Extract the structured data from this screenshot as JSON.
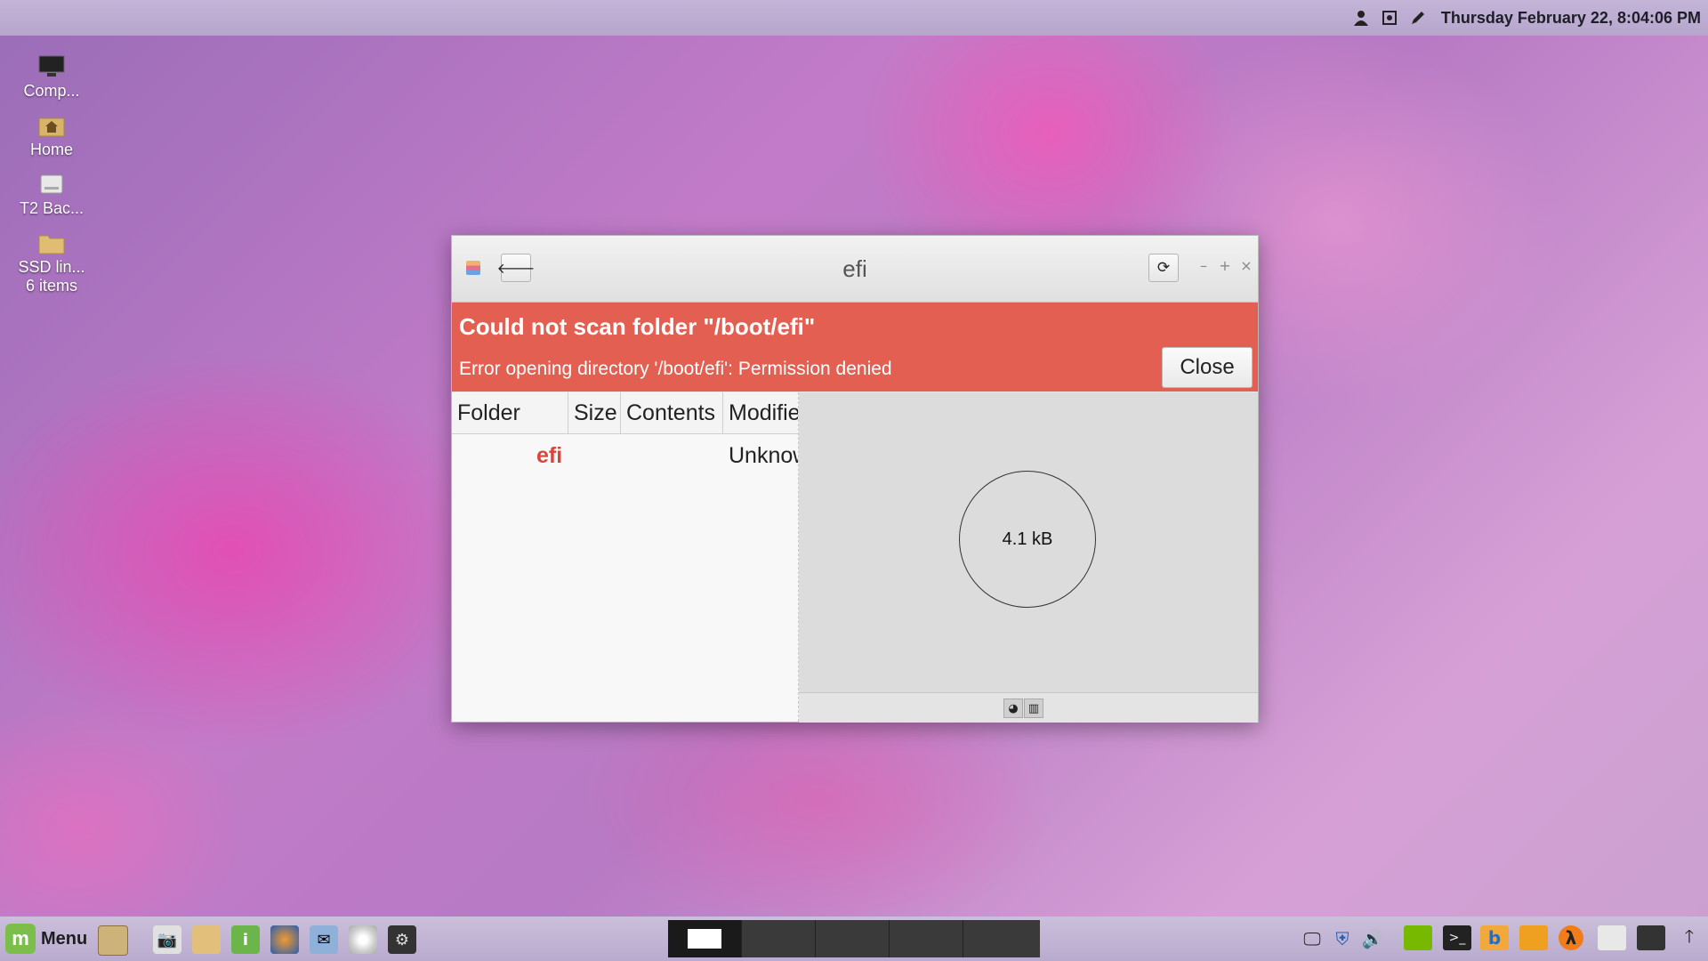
{
  "top_panel": {
    "clock": "Thursday February 22,  8:04:06 PM",
    "icons": [
      "user-icon",
      "screenshot-icon",
      "pen-icon"
    ]
  },
  "desktop": {
    "icons": [
      {
        "label": "Comp...",
        "sublabel": "",
        "icon": "computer-icon"
      },
      {
        "label": "Home",
        "sublabel": "",
        "icon": "home-folder-icon"
      },
      {
        "label": "T2 Bac...",
        "sublabel": "",
        "icon": "drive-icon"
      },
      {
        "label": "SSD lin...",
        "sublabel": "6 items",
        "icon": "folder-icon"
      }
    ]
  },
  "window": {
    "title": "efi",
    "error": {
      "title": "Could not scan folder \"/boot/efi\"",
      "message": "Error opening directory '/boot/efi': Permission denied",
      "close_label": "Close"
    },
    "columns": [
      "Folder",
      "Size",
      "Contents",
      "Modified"
    ],
    "rows": [
      {
        "folder": "efi",
        "size": "",
        "contents": "",
        "modified": "Unknown"
      }
    ],
    "chart": {
      "center_label": "4.1 kB"
    }
  },
  "taskbar": {
    "menu_label": "Menu",
    "launchers": [
      "show-desktop-icon",
      "camera-icon",
      "files-icon",
      "info-icon",
      "firefox-icon",
      "mail-icon",
      "disc-icon",
      "terminal-game-icon"
    ],
    "tray": [
      "display-icon",
      "shield-icon",
      "volume-icon",
      "nvidia-icon",
      "terminal-icon",
      "bing-icon",
      "game-icon",
      "half-life-icon",
      "app-icon",
      "steam-icon",
      "upload-arrow-icon"
    ]
  },
  "colors": {
    "error_bar": "#e25f52",
    "error_row_name": "#d9453b"
  }
}
